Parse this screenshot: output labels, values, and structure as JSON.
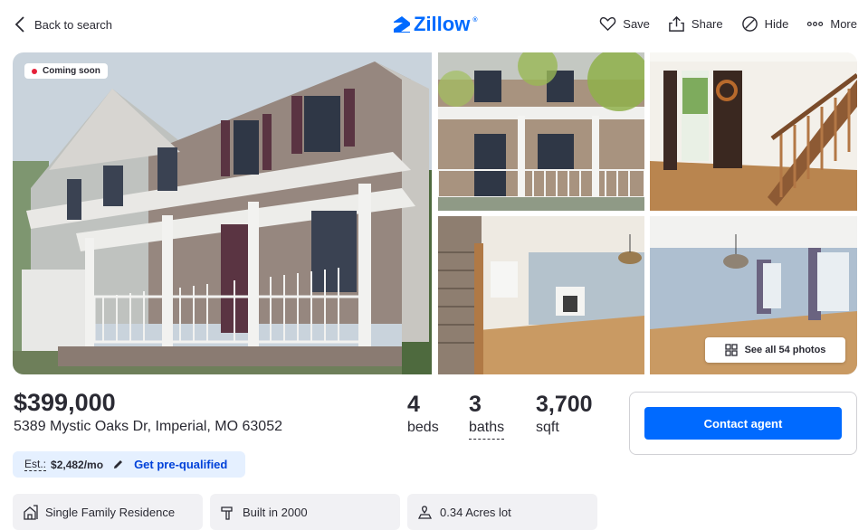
{
  "header": {
    "back_label": "Back to search",
    "logo_text": "Zillow",
    "logo_reg": "®",
    "actions": [
      {
        "label": "Save",
        "icon": "heart-icon"
      },
      {
        "label": "Share",
        "icon": "share-icon"
      },
      {
        "label": "Hide",
        "icon": "hide-icon"
      },
      {
        "label": "More",
        "icon": "more-icon"
      }
    ]
  },
  "gallery": {
    "badge": "Coming soon",
    "see_all": "See all 54 photos"
  },
  "summary": {
    "price": "$399,000",
    "address": "5389 Mystic Oaks Dr, Imperial, MO 63052",
    "beds": {
      "value": "4",
      "label": "beds"
    },
    "baths": {
      "value": "3",
      "label": "baths"
    },
    "sqft": {
      "value": "3,700",
      "label": "sqft"
    },
    "estimate": {
      "label": "Est.:",
      "amount": "$2,482/mo",
      "prequalify": "Get pre-qualified"
    }
  },
  "contact": {
    "button": "Contact agent"
  },
  "facts": [
    {
      "label": "Single Family Residence",
      "icon": "home-type-icon"
    },
    {
      "label": "Built in 2000",
      "icon": "hammer-icon"
    },
    {
      "label": "0.34 Acres lot",
      "icon": "lot-icon"
    }
  ],
  "colors": {
    "accent": "#006aff",
    "badge_dot": "#e5213a",
    "estimate_bg": "#e5f0ff",
    "link": "#0041d9"
  }
}
